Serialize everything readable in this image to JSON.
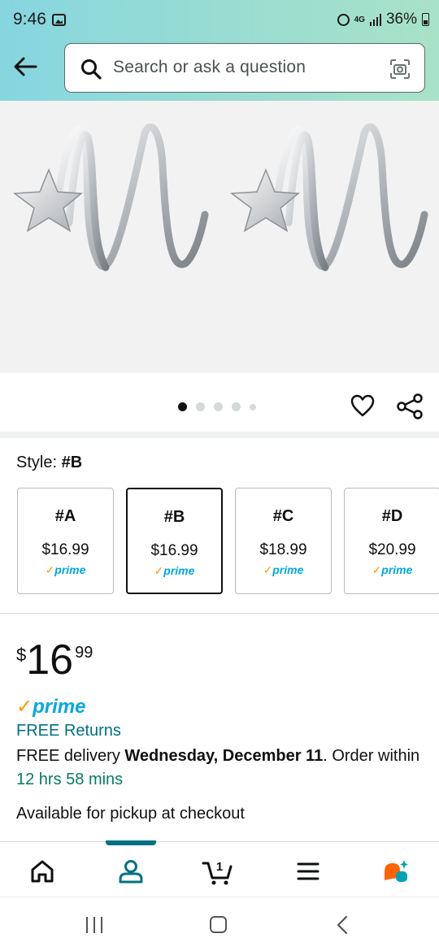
{
  "status": {
    "time": "9:46",
    "network": "4G",
    "battery": "36%"
  },
  "search": {
    "placeholder": "Search or ask a question"
  },
  "product": {
    "image_dots": 5,
    "active_dot": 0,
    "style_prefix": "Style: ",
    "style_value": "#B",
    "variants": [
      {
        "name": "#A",
        "price": "$16.99",
        "prime": "prime",
        "selected": false
      },
      {
        "name": "#B",
        "price": "$16.99",
        "prime": "prime",
        "selected": true
      },
      {
        "name": "#C",
        "price": "$18.99",
        "prime": "prime",
        "selected": false
      },
      {
        "name": "#D",
        "price": "$20.99",
        "prime": "prime",
        "selected": false
      }
    ],
    "price_symbol": "$",
    "price_whole": "16",
    "price_fraction": "99",
    "prime_label": "prime",
    "free_returns": "FREE Returns",
    "delivery_prefix": "FREE delivery ",
    "delivery_date": "Wednesday, December 11",
    "delivery_mid": ". Order within ",
    "delivery_countdown": "12 hrs 58 mins",
    "pickup": "Available for pickup at checkout"
  },
  "bottom_nav": {
    "items": [
      "home",
      "account",
      "cart",
      "menu",
      "rufus"
    ],
    "active": "account",
    "cart_count": "1"
  },
  "colors": {
    "accent": "#007185",
    "prime": "#00a8e1",
    "prime_check": "#ff9900",
    "countdown": "#067d62"
  }
}
